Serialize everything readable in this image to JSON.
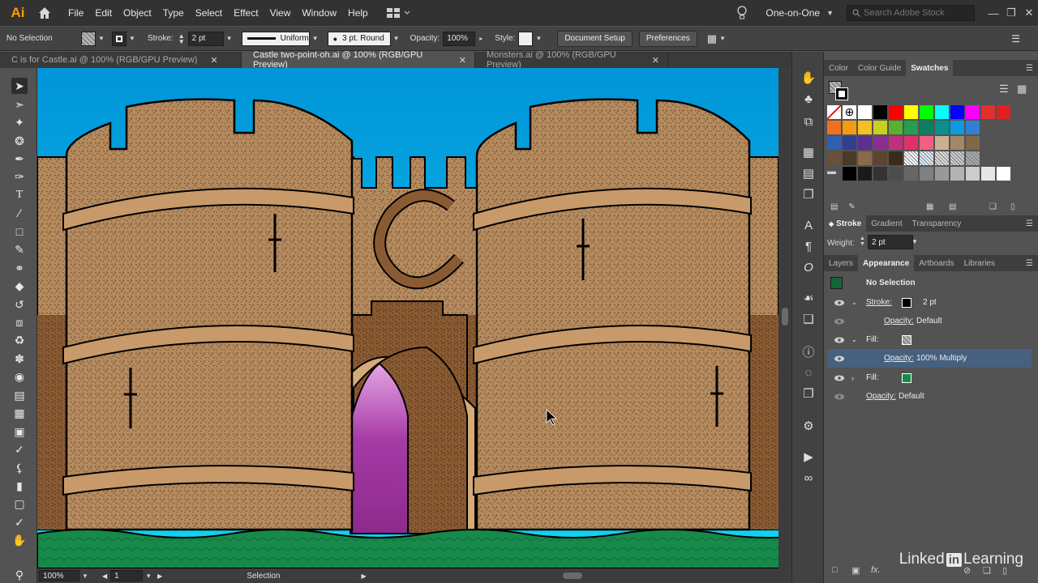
{
  "app": {
    "logo": "Ai",
    "workspace": "One-on-One",
    "search_placeholder": "Search Adobe Stock"
  },
  "menu": [
    "File",
    "Edit",
    "Object",
    "Type",
    "Select",
    "Effect",
    "View",
    "Window",
    "Help"
  ],
  "control": {
    "selection": "No Selection",
    "stroke_label": "Stroke:",
    "stroke_weight": "2 pt",
    "profile": "Uniform",
    "brush": "3 pt. Round",
    "opacity_label": "Opacity:",
    "opacity": "100%",
    "style_label": "Style:",
    "doc_setup": "Document Setup",
    "preferences": "Preferences"
  },
  "tabs": [
    {
      "label": "C is for Castle.ai @ 100% (RGB/GPU Preview)",
      "active": false
    },
    {
      "label": "Castle two-point-oh.ai @ 100% (RGB/GPU Preview)",
      "active": true
    },
    {
      "label": "Monsters.ai @ 100% (RGB/GPU Preview)",
      "active": false
    }
  ],
  "status": {
    "zoom": "100%",
    "artboard": "1",
    "tool": "Selection"
  },
  "panel_top_tabs": [
    "Color",
    "Color Guide",
    "Swatches"
  ],
  "stroke_panel": {
    "tabs": [
      "Stroke",
      "Gradient",
      "Transparency"
    ],
    "weight_label": "Weight:",
    "weight": "2 pt"
  },
  "appearance_tabs": [
    "Layers",
    "Appearance",
    "Artboards",
    "Libraries"
  ],
  "appearance": {
    "header": "No Selection",
    "stroke_label": "Stroke:",
    "stroke_value": "2 pt",
    "opacity1_label": "Opacity:",
    "opacity1_value": "Default",
    "fill1_label": "Fill:",
    "opacity2_label": "Opacity:",
    "opacity2_value": "100% Multiply",
    "fill2_label": "Fill:",
    "opacity3_label": "Opacity:",
    "opacity3_value": "Default"
  },
  "colors": {
    "swatch_row1": [
      "#ffffff",
      "#000000",
      "#ff0000",
      "#ffff00",
      "#00ff00",
      "#00ffff",
      "#0000ff",
      "#ff00ff",
      "#e03030",
      "#e02020"
    ],
    "swatch_row2": [
      "#f07020",
      "#f39c12",
      "#f6c022",
      "#c8d020",
      "#5bb030",
      "#22a050",
      "#0a8060",
      "#0a8f90",
      "#0a9be0",
      "#2f80d0"
    ],
    "swatch_row3": [
      "#2f5fb0",
      "#2f3f90",
      "#5a2f90",
      "#8a2f90",
      "#c02f80",
      "#e0306a",
      "#f06080",
      "#c8b090",
      "#a08868",
      "#806848"
    ],
    "swatch_row4": [
      "#6a5038",
      "#4a3828",
      "#8a6a4a",
      "#5e4430",
      "#3a2a1a"
    ],
    "grays": [
      "#000000",
      "#1a1a1a",
      "#333333",
      "#4d4d4d",
      "#666666",
      "#808080",
      "#999999",
      "#b3b3b3",
      "#cccccc",
      "#e6e6e6",
      "#ffffff"
    ]
  },
  "watermark": {
    "a": "Linked",
    "b": "in",
    "c": "Learning"
  }
}
